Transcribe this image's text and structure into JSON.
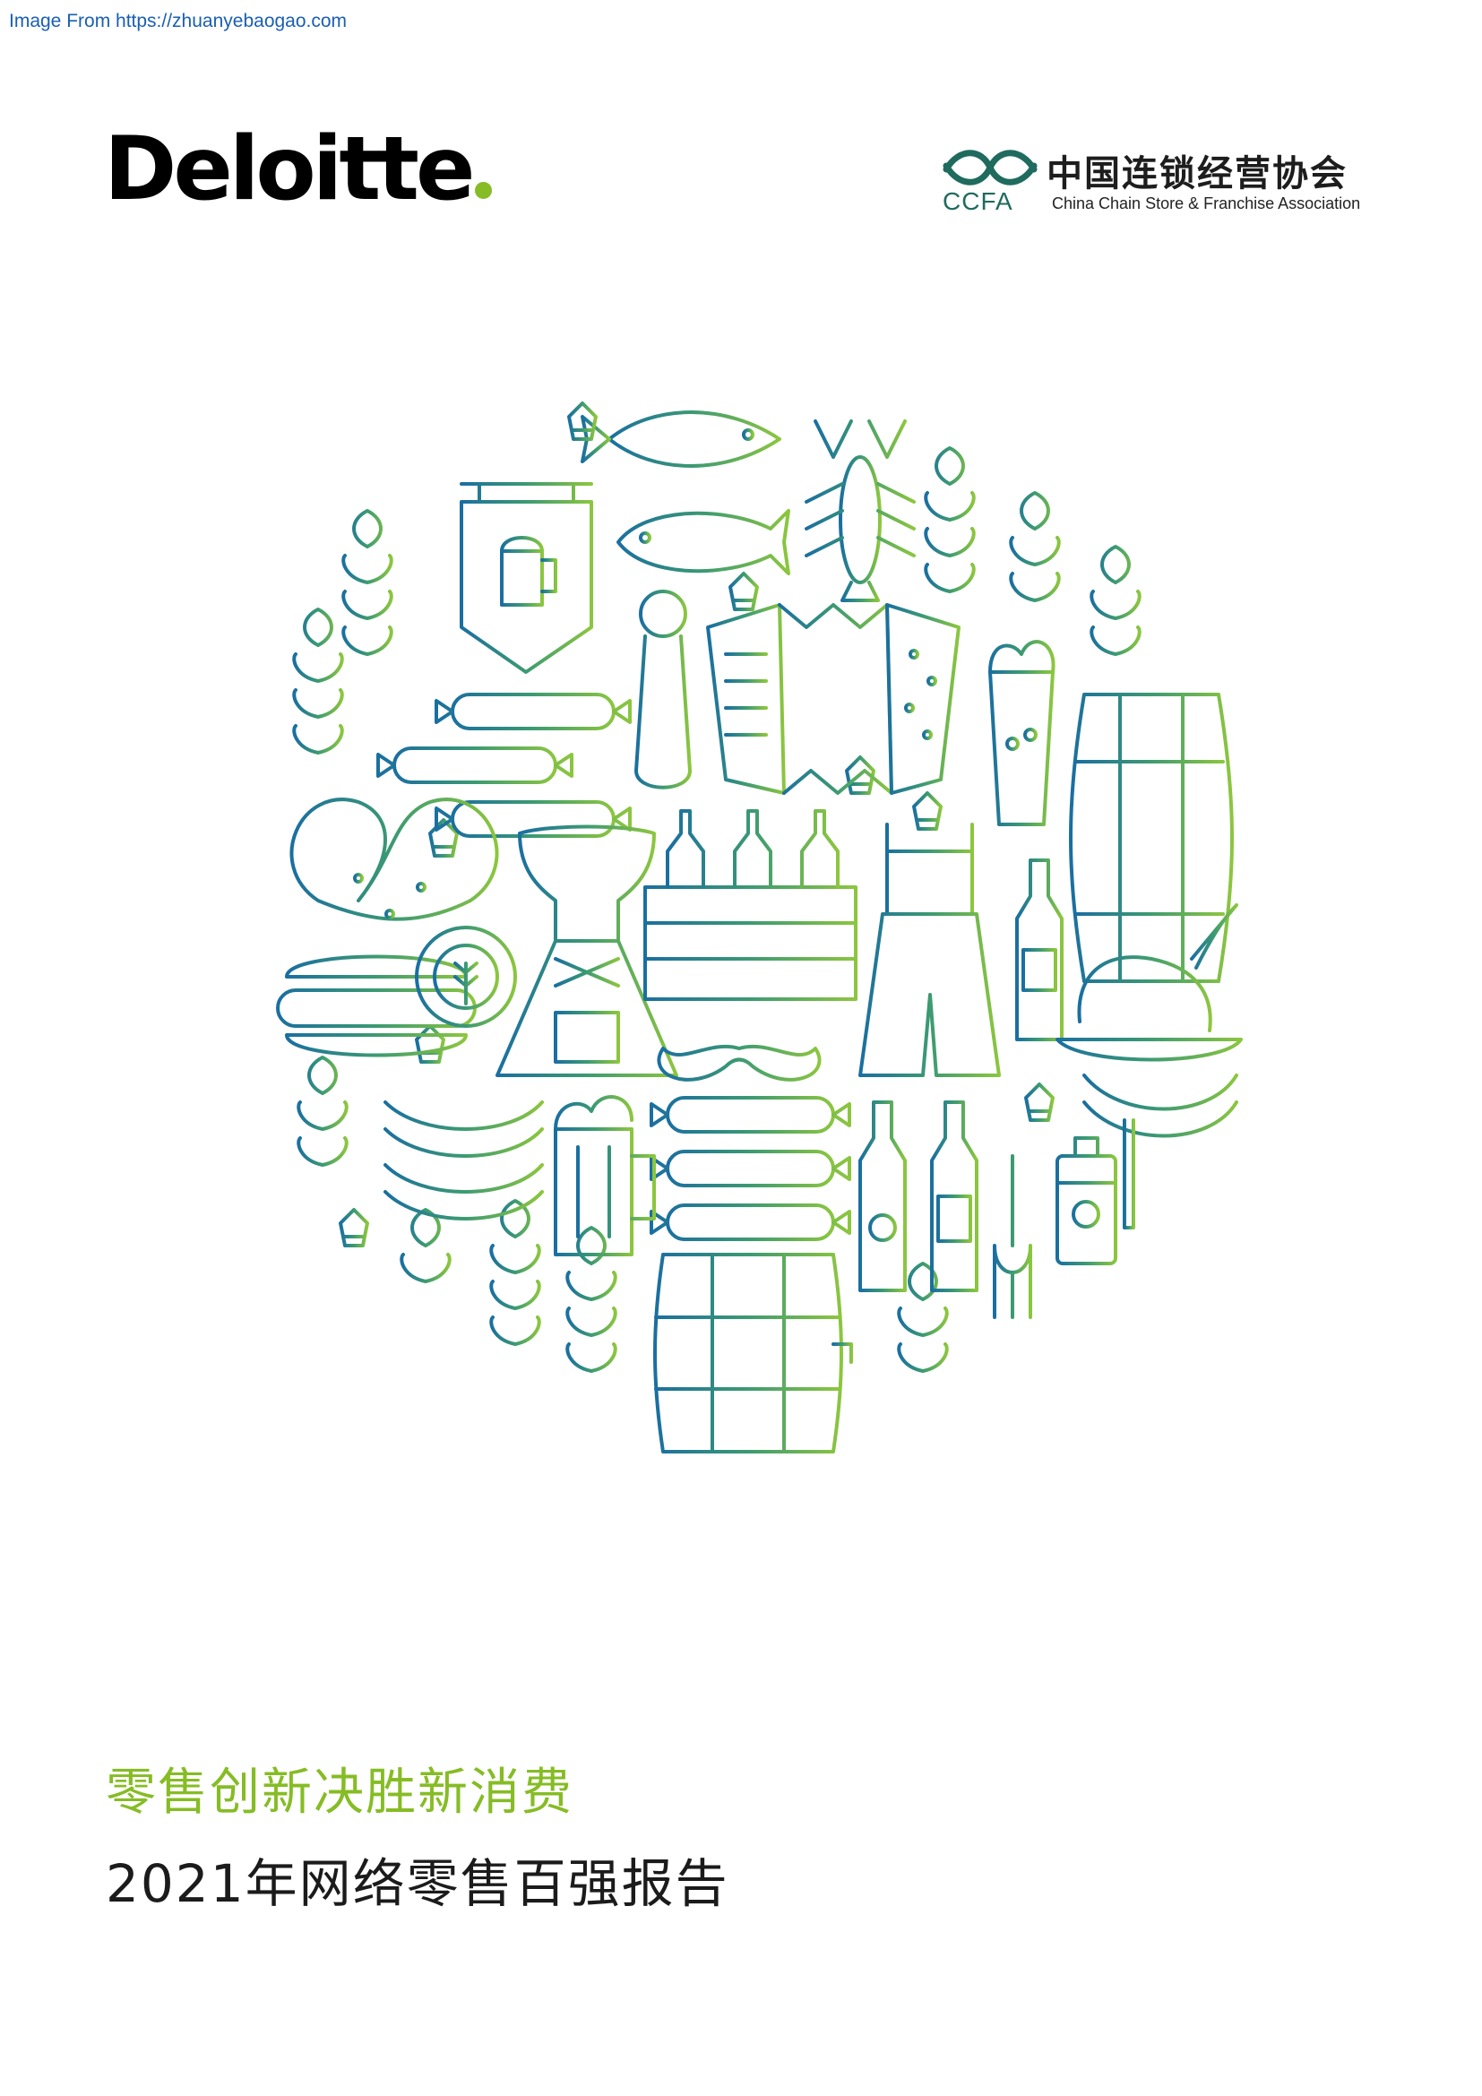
{
  "source": {
    "label": "Image From https://zhuanyebaogao.com"
  },
  "deloitte": {
    "wordmark": "Deloitte",
    "accent_color": "#86bc25"
  },
  "ccfa": {
    "name_zh": "中国连锁经营协会",
    "abbr": "CCFA",
    "name_en": "China Chain Store & Franchise Association",
    "color": "#1f6b5e"
  },
  "illustration": {
    "icons": [
      "fish-icon",
      "lobster-icon",
      "hop-icon",
      "wheat-icon",
      "beer-mug-icon",
      "pub-sign-icon",
      "sausage-icon",
      "bottle-opener-icon",
      "accordion-icon",
      "beer-glass-icon",
      "barrel-icon",
      "pretzel-icon",
      "dirndl-icon",
      "beer-crate-icon",
      "lederhosen-icon",
      "beer-bottle-icon",
      "hat-icon",
      "hotdog-icon",
      "mustache-icon",
      "fork-icon",
      "can-icon"
    ],
    "gradient": [
      "#1a6fa0",
      "#8cc63f"
    ]
  },
  "report": {
    "subtitle": "零售创新决胜新消费",
    "title": "2021年网络零售百强报告"
  }
}
